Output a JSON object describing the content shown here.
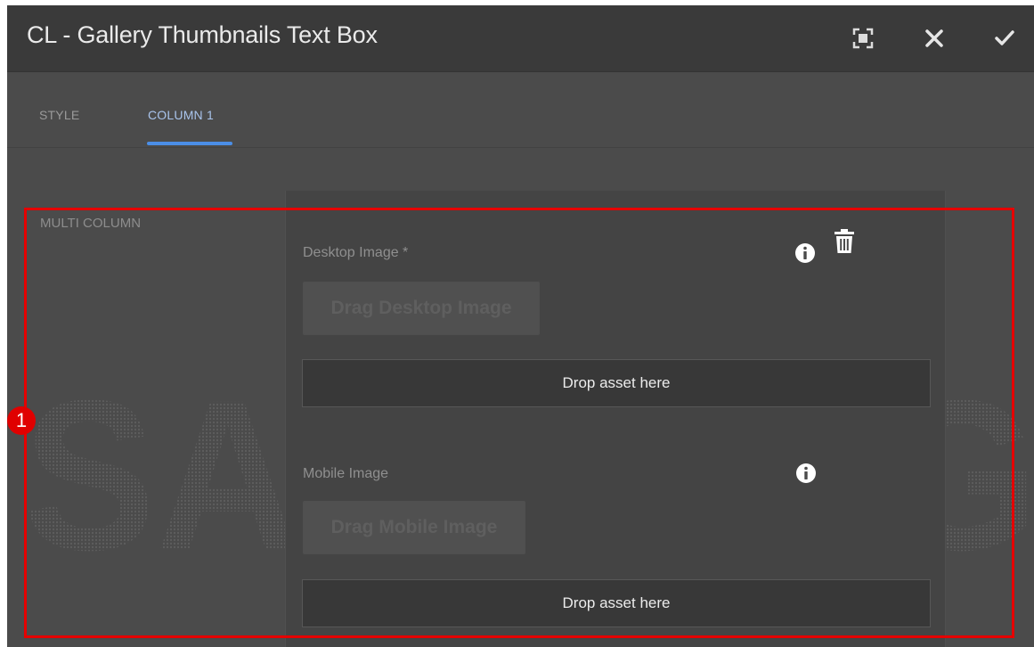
{
  "dialog": {
    "title": "CL - Gallery Thumbnails Text Box",
    "toolbar": {
      "fullscreen_icon": "fullscreen-icon",
      "close_icon": "close-icon",
      "confirm_icon": "check-icon"
    }
  },
  "tabs": [
    {
      "label": "STYLE",
      "active": false
    },
    {
      "label": "COLUMN 1",
      "active": true
    }
  ],
  "section": {
    "label": "MULTI COLUMN"
  },
  "fields": {
    "desktop": {
      "label": "Desktop Image *",
      "drag_label": "Drag Desktop Image",
      "drop_label": "Drop asset here"
    },
    "mobile": {
      "label": "Mobile Image",
      "drag_label": "Drag Mobile Image",
      "drop_label": "Drop asset here"
    }
  },
  "annotation": {
    "marker": "1",
    "color": "#e60000"
  },
  "watermark": {
    "text": "SAMSUNG"
  },
  "colors": {
    "accent": "#4b8ee6",
    "background": "#4b4b4b",
    "titlebar": "#3a3a3a"
  }
}
